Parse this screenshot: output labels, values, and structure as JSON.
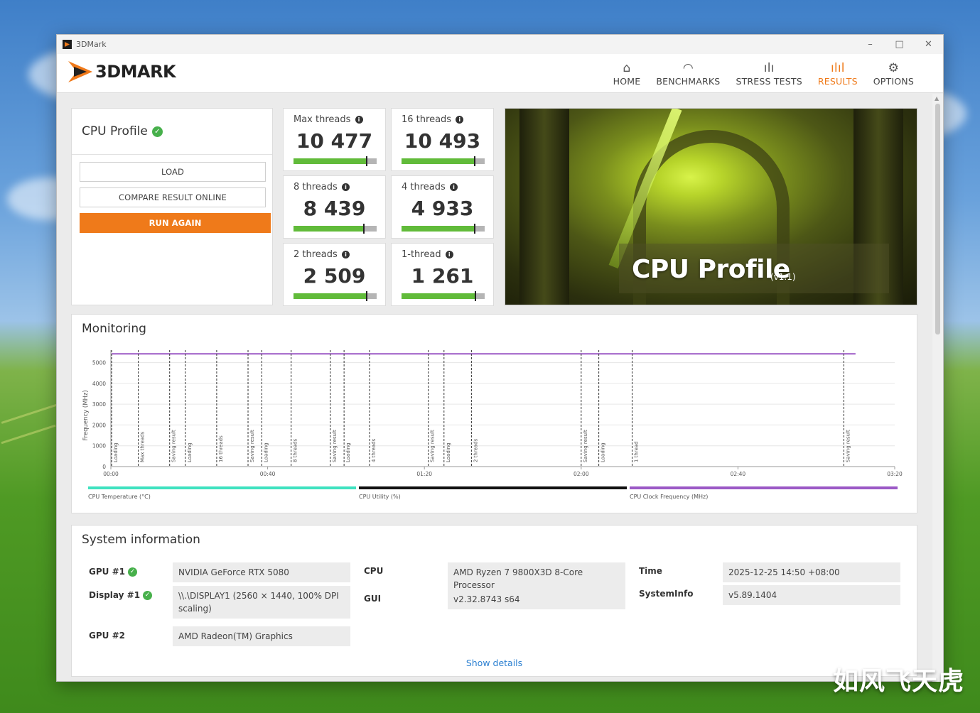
{
  "window": {
    "title": "3DMark",
    "controls": [
      "–",
      "□",
      "✕"
    ]
  },
  "brand": {
    "logo_text": "3DMARK"
  },
  "nav": [
    {
      "label": "HOME",
      "icon": "home-icon",
      "glyph": "⌂"
    },
    {
      "label": "BENCHMARKS",
      "icon": "gauge-icon",
      "glyph": "◠"
    },
    {
      "label": "STRESS TESTS",
      "icon": "stress-bars-icon",
      "glyph": "ılı"
    },
    {
      "label": "RESULTS",
      "icon": "results-chart-icon",
      "glyph": "ılıl",
      "active": true
    },
    {
      "label": "OPTIONS",
      "icon": "gear-icon",
      "glyph": "⚙"
    }
  ],
  "profile": {
    "title": "CPU Profile",
    "load_label": "LOAD",
    "compare_label": "COMPARE RESULT ONLINE",
    "run_again_label": "RUN AGAIN"
  },
  "scores": [
    {
      "label": "Max threads",
      "value": "10 477",
      "fill_fraction": 0.88
    },
    {
      "label": "16 threads",
      "value": "10 493",
      "fill_fraction": 0.88
    },
    {
      "label": "8 threads",
      "value": "8 439",
      "fill_fraction": 0.85
    },
    {
      "label": "4 threads",
      "value": "4 933",
      "fill_fraction": 0.88
    },
    {
      "label": "2 threads",
      "value": "2 509",
      "fill_fraction": 0.88
    },
    {
      "label": "1-thread",
      "value": "1 261",
      "fill_fraction": 0.89
    }
  ],
  "hero": {
    "caption": "CPU Profile",
    "version": "(v1.1)"
  },
  "monitoring": {
    "title": "Monitoring",
    "chart_data": {
      "type": "line",
      "ylabel": "Frequency (MHz)",
      "yticks": [
        0,
        1000,
        2000,
        3000,
        4000,
        5000
      ],
      "ylim": [
        0,
        5600
      ],
      "xticks": [
        "00:00",
        "00:40",
        "01:20",
        "02:00",
        "02:40",
        "03:20"
      ],
      "xlim_seconds": [
        0,
        200
      ],
      "series": [
        {
          "name": "CPU Clock Frequency (MHz)",
          "color": "#9b59c6",
          "x_seconds": [
            0.2,
            190
          ],
          "values": [
            5420,
            5420
          ]
        }
      ],
      "markers": [
        {
          "t": 0.2,
          "label": "Loading"
        },
        {
          "t": 7,
          "label": "Max threads"
        },
        {
          "t": 15,
          "label": "Saving result"
        },
        {
          "t": 19,
          "label": "Loading"
        },
        {
          "t": 27,
          "label": "16 threads"
        },
        {
          "t": 35,
          "label": "Saving result"
        },
        {
          "t": 38.5,
          "label": "Loading"
        },
        {
          "t": 46,
          "label": "8 threads"
        },
        {
          "t": 56,
          "label": "Saving result"
        },
        {
          "t": 59.5,
          "label": "Loading"
        },
        {
          "t": 66,
          "label": "4 threads"
        },
        {
          "t": 81,
          "label": "Saving result"
        },
        {
          "t": 85,
          "label": "Loading"
        },
        {
          "t": 92,
          "label": "2 threads"
        },
        {
          "t": 120,
          "label": "Saving result"
        },
        {
          "t": 124.5,
          "label": "Loading"
        },
        {
          "t": 133,
          "label": "1 thread"
        },
        {
          "t": 187,
          "label": "Saving result"
        }
      ]
    },
    "legend": [
      {
        "label": "CPU Temperature (°C)",
        "color": "#3fe2c0"
      },
      {
        "label": "CPU Utility (%)",
        "color": "#111111"
      },
      {
        "label": "CPU Clock Frequency (MHz)",
        "color": "#9b59c6"
      }
    ]
  },
  "system_info": {
    "title": "System information",
    "gpu1_label": "GPU #1",
    "gpu1_value": "NVIDIA GeForce RTX 5080",
    "display1_label": "Display #1",
    "display1_value": "\\\\.\\DISPLAY1 (2560 × 1440, 100% DPI scaling)",
    "gpu2_label": "GPU #2",
    "gpu2_value": "AMD Radeon(TM) Graphics",
    "cpu_label": "CPU",
    "cpu_value": "AMD Ryzen 7 9800X3D 8-Core Processor",
    "gui_label": "GUI",
    "gui_value": "v2.32.8743 s64",
    "time_label": "Time",
    "time_value": "2025-12-25 14:50 +08:00",
    "sysinfo_label": "SystemInfo",
    "sysinfo_value": "v5.89.1404",
    "show_details": "Show details"
  },
  "watermark": "如风飞天虎"
}
